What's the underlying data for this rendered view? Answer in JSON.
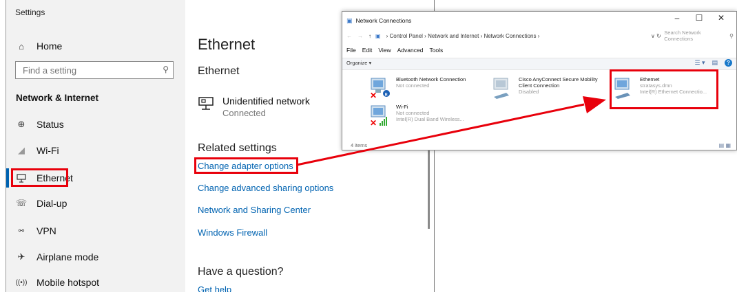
{
  "settings": {
    "window_title": "Settings",
    "home": "Home",
    "search_placeholder": "Find a setting",
    "section_title": "Network & Internet",
    "nav": [
      {
        "label": "Status",
        "icon": "globe-icon"
      },
      {
        "label": "Wi-Fi",
        "icon": "wifi-icon"
      },
      {
        "label": "Ethernet",
        "icon": "ethernet-icon"
      },
      {
        "label": "Dial-up",
        "icon": "phone-icon"
      },
      {
        "label": "VPN",
        "icon": "vpn-icon"
      },
      {
        "label": "Airplane mode",
        "icon": "airplane-icon"
      },
      {
        "label": "Mobile hotspot",
        "icon": "hotspot-icon"
      }
    ],
    "content": {
      "page_title": "Ethernet",
      "subheading": "Ethernet",
      "network_name": "Unidentified network",
      "network_status": "Connected",
      "related_title": "Related settings",
      "links": [
        "Change adapter options",
        "Change advanced sharing options",
        "Network and Sharing Center",
        "Windows Firewall"
      ],
      "question_title": "Have a question?",
      "get_help": "Get help"
    }
  },
  "netconn": {
    "title": "Network Connections",
    "controls": [
      "–",
      "☐",
      "✕"
    ],
    "breadcrumb": [
      "Control Panel",
      "Network and Internet",
      "Network Connections"
    ],
    "search_placeholder": "Search Network Connections",
    "menu": [
      "File",
      "Edit",
      "View",
      "Advanced",
      "Tools"
    ],
    "organize": "Organize ▾",
    "adapters": [
      {
        "name": "Bluetooth Network Connection",
        "status": "Not connected",
        "detail": ""
      },
      {
        "name": "Cisco AnyConnect Secure Mobility Client Connection",
        "status": "Disabled",
        "detail": ""
      },
      {
        "name": "Ethernet",
        "status": "stratasys.dmn",
        "detail": "Intel(R) Ethernet Connectio..."
      },
      {
        "name": "Wi-Fi",
        "status": "Not connected",
        "detail": "Intel(R) Dual Band Wireless..."
      }
    ],
    "item_count": "4 items"
  },
  "colors": {
    "highlight": "#e8000b",
    "link": "#0063b1",
    "accent": "#0063b1"
  }
}
